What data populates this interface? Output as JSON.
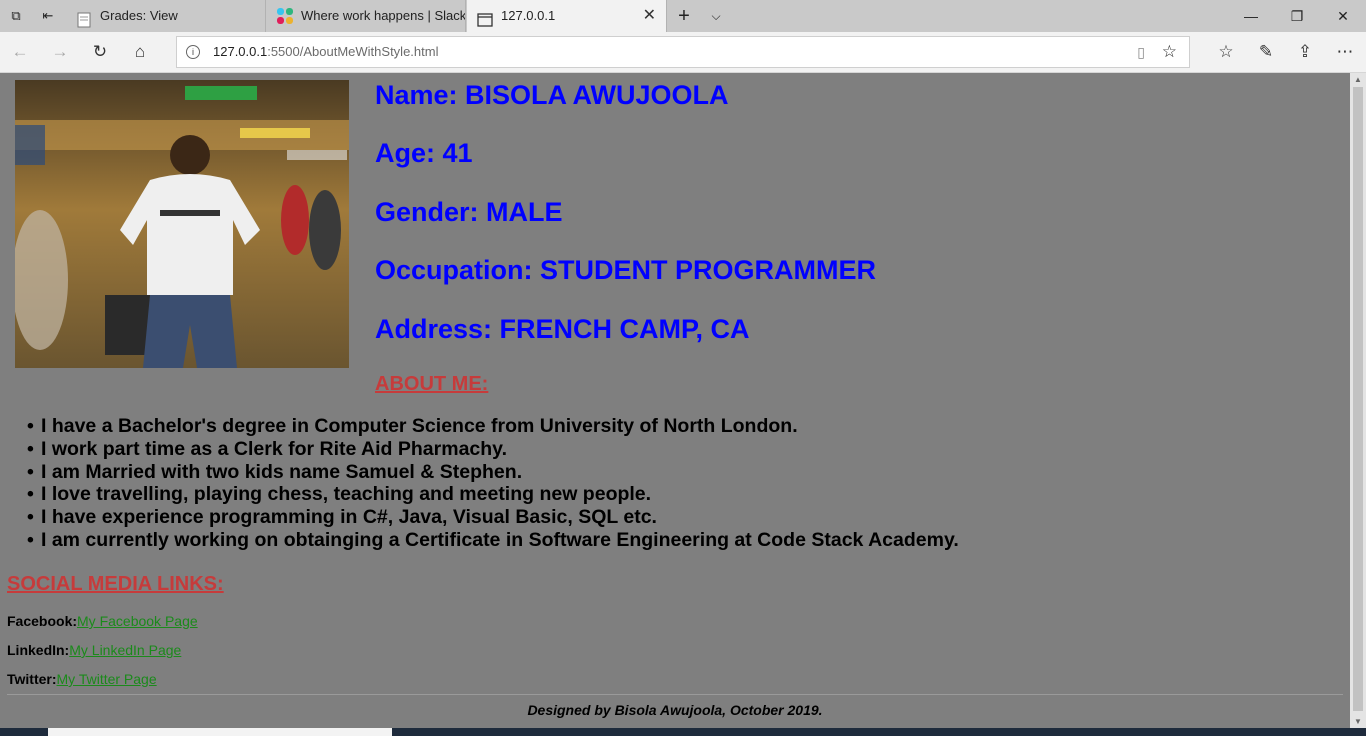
{
  "browser": {
    "tabs": [
      {
        "title": "Grades: View",
        "icon": "document-icon"
      },
      {
        "title": "Where work happens | Slack",
        "icon": "slack-icon"
      },
      {
        "title": "127.0.0.1",
        "icon": "page-icon",
        "active": true
      }
    ],
    "url_host": "127.0.0.1",
    "url_rest": ":5500/AboutMeWithStyle.html"
  },
  "profile": {
    "name_line": "Name: BISOLA AWUJOOLA",
    "age_line": "Age: 41",
    "gender_line": "Gender: MALE",
    "occupation_line": "Occupation: STUDENT PROGRAMMER",
    "address_line": "Address: FRENCH CAMP, CA"
  },
  "about": {
    "heading": "ABOUT ME:",
    "items": [
      "I have a Bachelor's degree in Computer Science from University of North London.",
      "I work part time as a Clerk for Rite Aid Pharmachy.",
      "I am Married with two kids name Samuel & Stephen.",
      "I love travelling, playing chess, teaching and meeting new people.",
      "I have experience programming in C#, Java, Visual Basic, SQL etc.",
      "I am currently working on obtainging a Certificate in Software Engineering at Code Stack Academy."
    ]
  },
  "social": {
    "heading": "SOCIAL MEDIA LINKS:",
    "links": [
      {
        "label": "Facebook:",
        "text": "My Facebook Page"
      },
      {
        "label": "LinkedIn:",
        "text": "My LinkedIn Page"
      },
      {
        "label": "Twitter:",
        "text": "My Twitter Page"
      }
    ]
  },
  "footer": {
    "text": "Designed by Bisola Awujoola, October 2019."
  },
  "colors": {
    "page_bg": "#7f7f7f",
    "info_text": "#0000ff",
    "heading": "#c63b3b",
    "link": "#1b8a1b"
  }
}
